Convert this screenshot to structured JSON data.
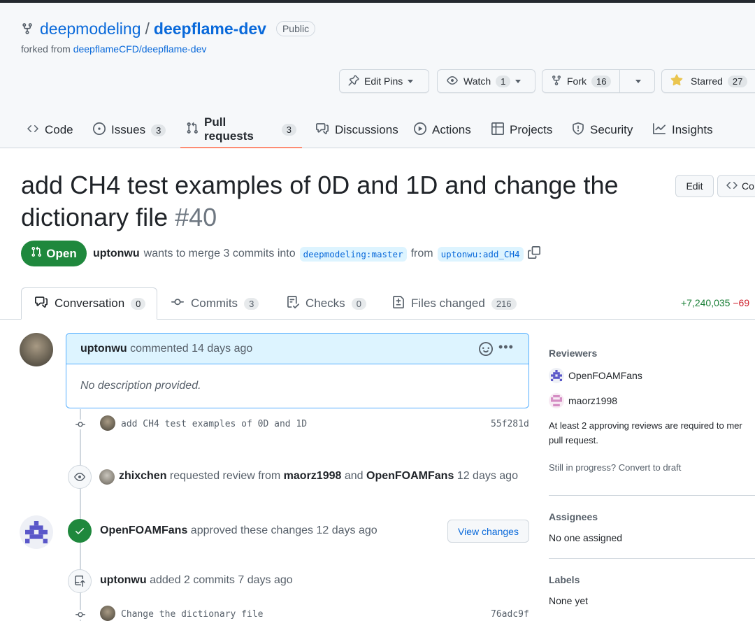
{
  "repo": {
    "owner": "deepmodeling",
    "separator": "/",
    "name": "deepflame-dev",
    "visibility": "Public",
    "forked_prefix": "forked from",
    "forked_source": "deepflameCFD/deepflame-dev"
  },
  "actions": {
    "edit_pins": "Edit Pins",
    "watch": "Watch",
    "watch_count": "1",
    "fork": "Fork",
    "fork_count": "16",
    "starred": "Starred",
    "star_count": "27"
  },
  "nav": {
    "code": "Code",
    "issues": "Issues",
    "issues_count": "3",
    "pull_requests": "Pull requests",
    "pr_count": "3",
    "discussions": "Discussions",
    "actions": "Actions",
    "projects": "Projects",
    "security": "Security",
    "insights": "Insights"
  },
  "pr": {
    "title_line1": "add CH4 test examples of 0D and 1D and change the",
    "title_line2": "dictionary file",
    "number": "#40",
    "edit": "Edit",
    "code_button": "Co",
    "state": "Open",
    "author": "uptonwu",
    "merge_text": "wants to merge 3 commits into",
    "base_branch": "deepmodeling:master",
    "from": "from",
    "head_branch": "uptonwu:add_CH4"
  },
  "tabs": {
    "conversation": "Conversation",
    "conversation_count": "0",
    "commits": "Commits",
    "commits_count": "3",
    "checks": "Checks",
    "checks_count": "0",
    "files_changed": "Files changed",
    "files_count": "216",
    "additions": "+7,240,035",
    "deletions": "−69"
  },
  "timeline": {
    "comment_author": "uptonwu",
    "comment_meta": "commented 14 days ago",
    "comment_body": "No description provided.",
    "commit1_msg": "add CH4 test examples of 0D and 1D",
    "commit1_sha": "55f281d",
    "review_req_actor": "zhixchen",
    "review_req_text1": "requested review from",
    "review_req_user1": "maorz1998",
    "review_req_and": "and",
    "review_req_user2": "OpenFOAMFans",
    "review_req_time": "12 days ago",
    "approve_actor": "OpenFOAMFans",
    "approve_text": "approved these changes 12 days ago",
    "view_changes": "View changes",
    "added_actor": "uptonwu",
    "added_text": "added 2 commits 7 days ago",
    "commit2_msg": "Change the dictionary file",
    "commit2_sha": "76adc9f"
  },
  "sidebar": {
    "reviewers_heading": "Reviewers",
    "reviewer1": "OpenFOAMFans",
    "reviewer2": "maorz1998",
    "approval_note_line1": "At least 2 approving reviews are required to mer",
    "approval_note_line2": "pull request.",
    "in_progress": "Still in progress?",
    "convert_draft": "Convert to draft",
    "assignees_heading": "Assignees",
    "assignees_value": "No one assigned",
    "labels_heading": "Labels",
    "labels_value": "None yet"
  },
  "colors": {
    "link": "#0969da",
    "open_green": "#1f883d",
    "active_tab_underline": "#fd8c73",
    "comment_header": "#ddf4ff"
  }
}
